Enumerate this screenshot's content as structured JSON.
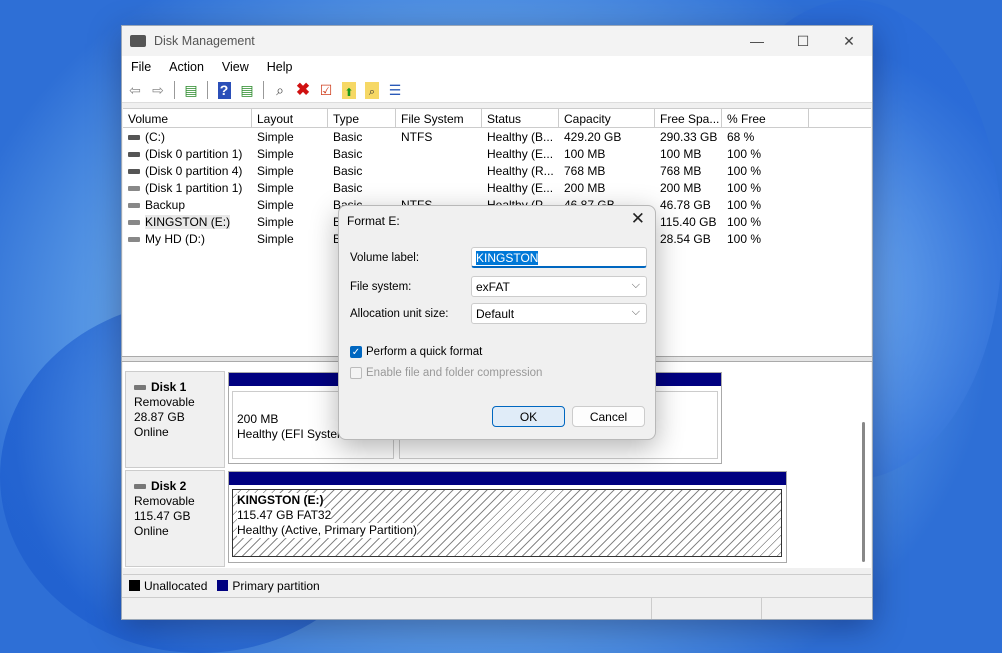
{
  "window": {
    "title": "Disk Management",
    "minimize": "—",
    "maximize": "☐",
    "close": "✕"
  },
  "menu": [
    "File",
    "Action",
    "View",
    "Help"
  ],
  "toolbar": [
    "back-icon",
    "forward-icon",
    "console-tree-icon",
    "help-icon",
    "action-pane-icon",
    "connect-icon",
    "delete-icon",
    "check-icon",
    "folder-up-icon",
    "folder-search-icon",
    "properties-icon"
  ],
  "columns": [
    "Volume",
    "Layout",
    "Type",
    "File System",
    "Status",
    "Capacity",
    "Free Spa...",
    "% Free"
  ],
  "volumes": [
    [
      "(C:)",
      "Simple",
      "Basic",
      "NTFS",
      "Healthy (B...",
      "429.20 GB",
      "290.33 GB",
      "68 %"
    ],
    [
      "(Disk 0 partition 1)",
      "Simple",
      "Basic",
      "",
      "Healthy (E...",
      "100 MB",
      "100 MB",
      "100 %"
    ],
    [
      "(Disk 0 partition 4)",
      "Simple",
      "Basic",
      "",
      "Healthy (R...",
      "768 MB",
      "768 MB",
      "100 %"
    ],
    [
      "(Disk 1 partition 1)",
      "Simple",
      "Basic",
      "",
      "Healthy (E...",
      "200 MB",
      "200 MB",
      "100 %"
    ],
    [
      "Backup",
      "Simple",
      "Basic",
      "NTFS",
      "Healthy (P...",
      "46.87 GB",
      "46.78 GB",
      "100 %"
    ],
    [
      "KINGSTON (E:)",
      "Simple",
      "Basic",
      "",
      "",
      "",
      "115.40 GB",
      "100 %"
    ],
    [
      "My HD (D:)",
      "Simple",
      "Basic",
      "",
      "",
      "",
      "28.54 GB",
      "100 %"
    ]
  ],
  "disks": [
    {
      "name": "Disk 1",
      "type": "Removable",
      "size": "28.87 GB",
      "state": "Online",
      "partition_size": "200 MB",
      "partition_status": "Healthy (EFI System"
    },
    {
      "name": "Disk 2",
      "type": "Removable",
      "size": "115.47 GB",
      "state": "Online",
      "partition_name": "KINGSTON  (E:)",
      "partition_size": "115.47 GB FAT32",
      "partition_status": "Healthy (Active, Primary Partition)"
    }
  ],
  "legend": {
    "unallocated": "Unallocated",
    "primary": "Primary partition",
    "unallocated_color": "#000000",
    "primary_color": "#000080"
  },
  "dialog": {
    "title": "Format E:",
    "close": "✕",
    "volume_label_label": "Volume label:",
    "volume_label_value": "KINGSTON",
    "file_system_label": "File system:",
    "file_system_value": "exFAT",
    "alloc_label": "Allocation unit size:",
    "alloc_value": "Default",
    "quick_format": "Perform a quick format",
    "quick_format_checked": true,
    "compression": "Enable file and folder compression",
    "compression_checked": false,
    "ok": "OK",
    "cancel": "Cancel"
  }
}
